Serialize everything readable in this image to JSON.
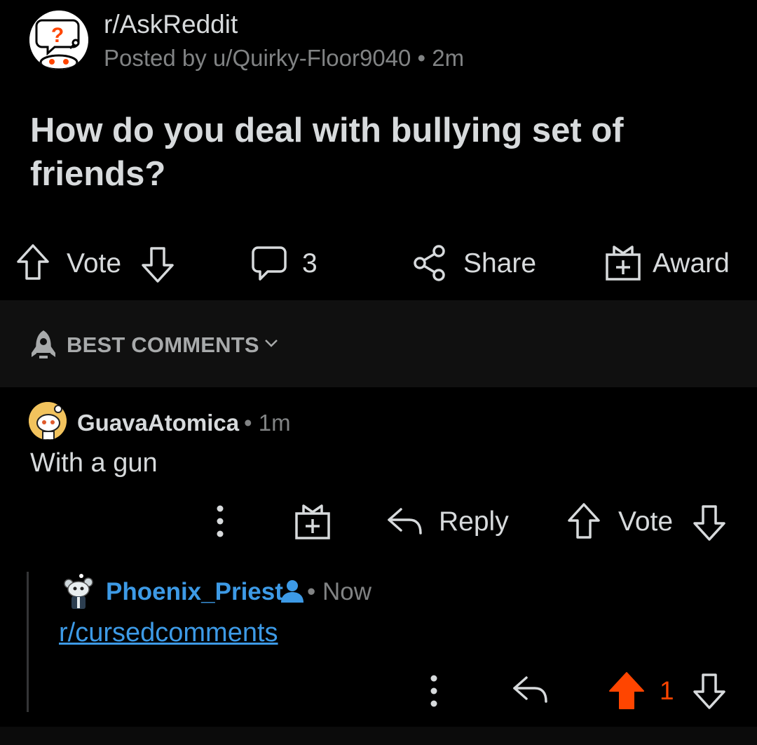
{
  "post": {
    "subreddit": "r/AskReddit",
    "meta": "Posted by u/Quirky-Floor9040 • 2m",
    "title": "How do you deal with bullying set of friends?",
    "avatar_icon": "snoo-question-icon"
  },
  "actions": {
    "vote_label": "Vote",
    "comment_count": "3",
    "share_label": "Share",
    "award_label": "Award"
  },
  "sort": {
    "label": "BEST COMMENTS",
    "icon": "rocket-icon"
  },
  "comments": [
    {
      "author": "GuavaAtomica",
      "time": "• 1m",
      "body": "With a gun",
      "reply_label": "Reply",
      "vote_label": "Vote"
    },
    {
      "author": "Phoenix_Priest",
      "time": "• Now",
      "body": "r/cursedcomments",
      "score": "1",
      "upvoted": true,
      "upvote_color": "#ff4500"
    }
  ],
  "colors": {
    "background": "#000000",
    "text": "#d7dadc",
    "meta": "#818384",
    "link": "#3d9ae6",
    "upvote": "#ff4500"
  }
}
